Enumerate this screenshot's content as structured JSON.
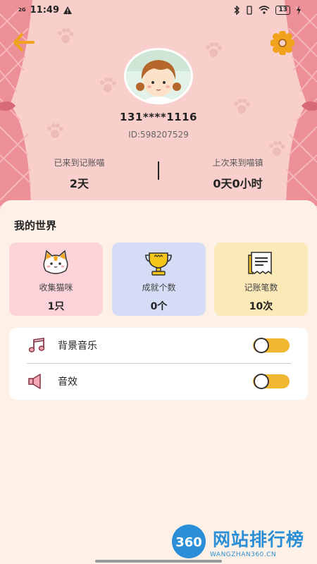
{
  "status_bar": {
    "time": "11:49",
    "network_label": "2G",
    "battery": "13"
  },
  "profile": {
    "phone": "131****1116",
    "user_id": "ID:598207529"
  },
  "stats": {
    "days_label": "已来到记账喵",
    "days_value": "2天",
    "last_visit_label": "上次来到喵镇",
    "last_visit_value": "0天0小时"
  },
  "world": {
    "title": "我的世界",
    "cards": [
      {
        "label": "收集猫咪",
        "value": "1只"
      },
      {
        "label": "成就个数",
        "value": "0个"
      },
      {
        "label": "记账笔数",
        "value": "10次"
      }
    ]
  },
  "settings": {
    "music_label": "背景音乐",
    "music_on": false,
    "sound_label": "音效",
    "sound_on": false
  },
  "watermark": {
    "title": "网站排行榜",
    "subtitle": "WANGZHAN360.CN",
    "logo_text": "360"
  },
  "colors": {
    "top_bg": "#f9cfcc",
    "panel_bg": "#fdf0e7",
    "card_pink": "#fbd3d9",
    "card_blue": "#d5dcf5",
    "card_yellow": "#fce9b8",
    "toggle": "#f2b731",
    "accent_orange": "#f0a21c"
  }
}
